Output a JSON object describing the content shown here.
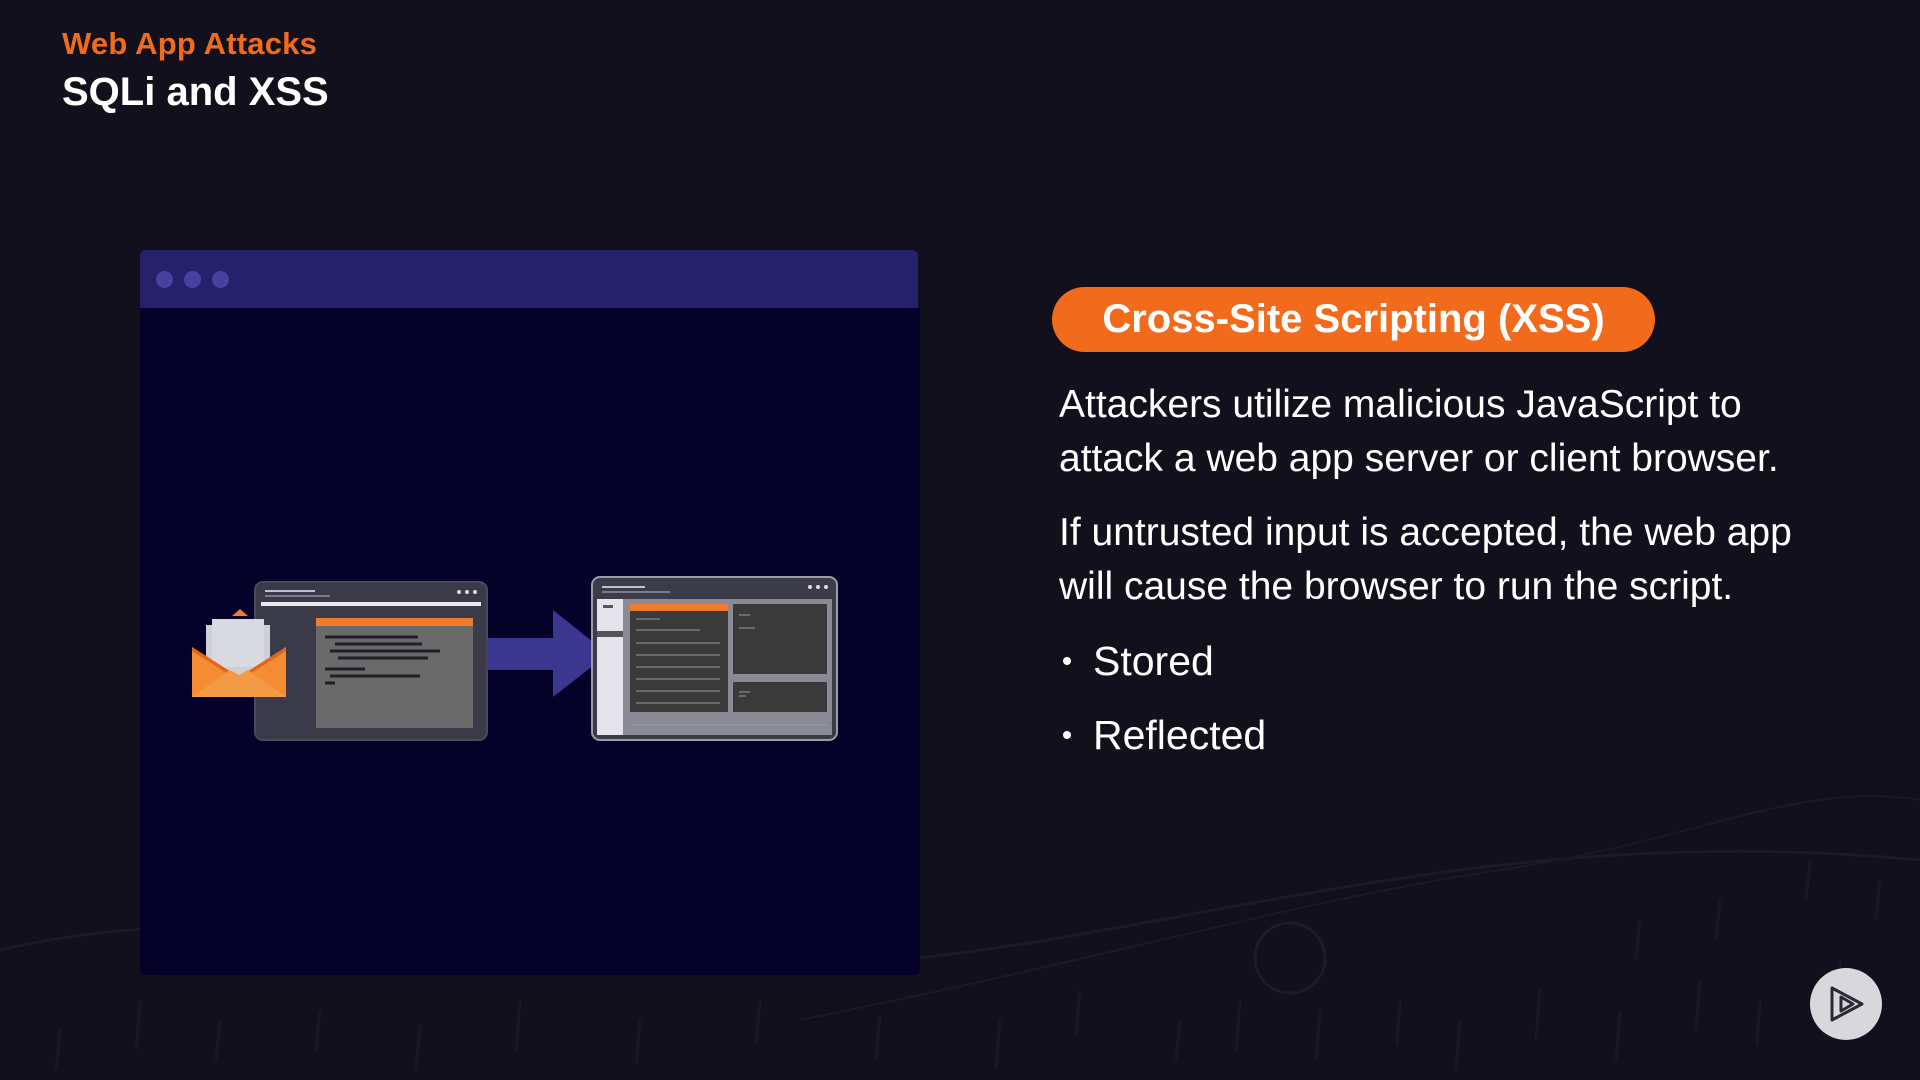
{
  "header": {
    "subtitle": "Web App Attacks",
    "title": "SQLi and XSS"
  },
  "badge": {
    "label": "Cross-Site Scripting (XSS)"
  },
  "body": {
    "paragraphs": [
      "Attackers utilize malicious JavaScript to attack a web app  server or client browser.",
      "If untrusted input is accepted, the web app will cause the browser to run the script."
    ],
    "bullets": [
      "Stored",
      "Reflected"
    ]
  },
  "colors": {
    "accent": "#f26a1b",
    "background": "#12101c",
    "browser_bar": "#27206a",
    "browser_body": "#040228",
    "arrow": "#3b3690"
  },
  "icons": {
    "play": "play-logo-icon",
    "envelope": "envelope-icon",
    "arrow": "arrow-right-icon"
  }
}
